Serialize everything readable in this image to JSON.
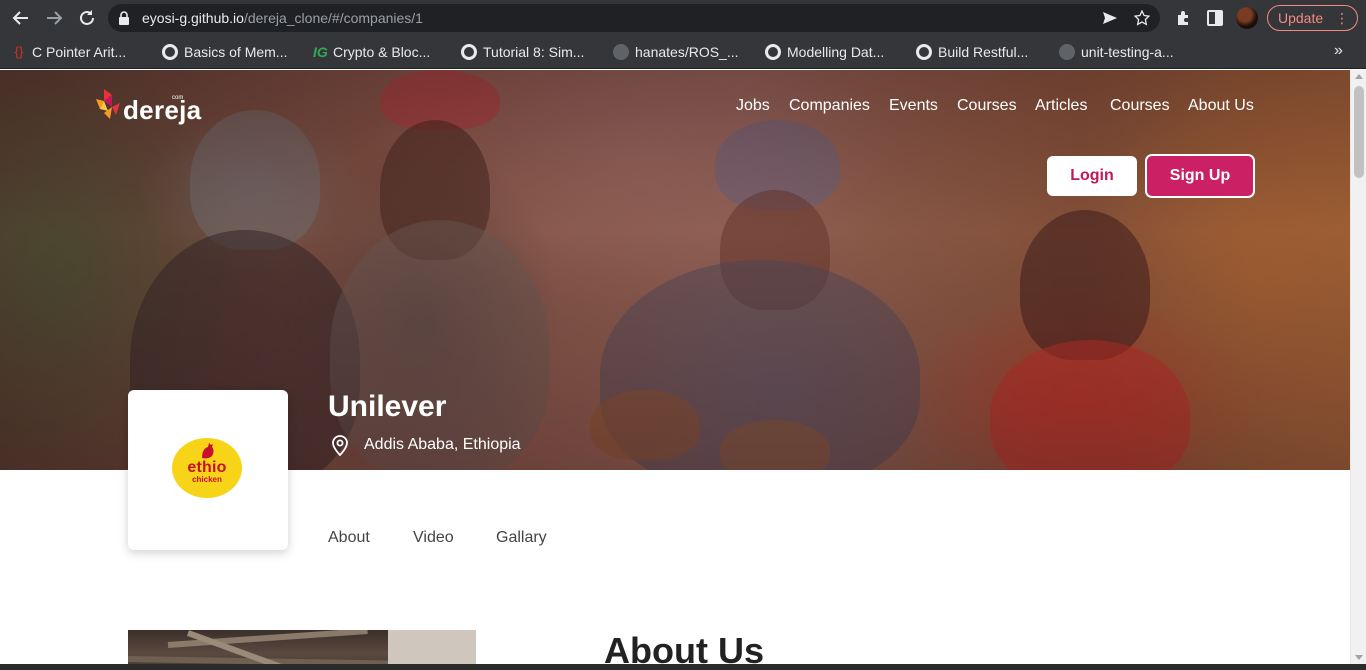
{
  "browser": {
    "url_host": "eyosi-g.github.io",
    "url_path": "/dereja_clone/#/companies/1",
    "update_label": "Update",
    "update_more": "⋮",
    "bookmarks_more": "»",
    "bookmarks": [
      {
        "label": "C Pointer Arit...",
        "icon": "code-brace-icon"
      },
      {
        "label": "Basics of Mem...",
        "icon": "globe-icon"
      },
      {
        "label": "Crypto & Bloc...",
        "icon": "ig-icon"
      },
      {
        "label": "Tutorial 8: Sim...",
        "icon": "globe-icon"
      },
      {
        "label": "hanates/ROS_...",
        "icon": "github-icon"
      },
      {
        "label": "Modelling Dat...",
        "icon": "globe-icon"
      },
      {
        "label": "Build Restful...",
        "icon": "globe-icon"
      },
      {
        "label": "unit-testing-a...",
        "icon": "github-icon"
      }
    ]
  },
  "site": {
    "logo_text": "dereja",
    "logo_suffix": "com",
    "nav": [
      "Jobs",
      "Companies",
      "Events",
      "Courses",
      "Articles",
      "Courses",
      "About Us"
    ],
    "login_label": "Login",
    "signup_label": "Sign Up",
    "brand_color": "#cc2064"
  },
  "company": {
    "name": "Unilever",
    "location": "Addis Ababa, Ethiopia",
    "logo_word": "ethio",
    "logo_sub": "chicken",
    "logo_bg": "#f7d417",
    "logo_fg": "#c8102e"
  },
  "tabs": [
    "About",
    "Video",
    "Gallary"
  ],
  "about": {
    "title": "About Us"
  }
}
